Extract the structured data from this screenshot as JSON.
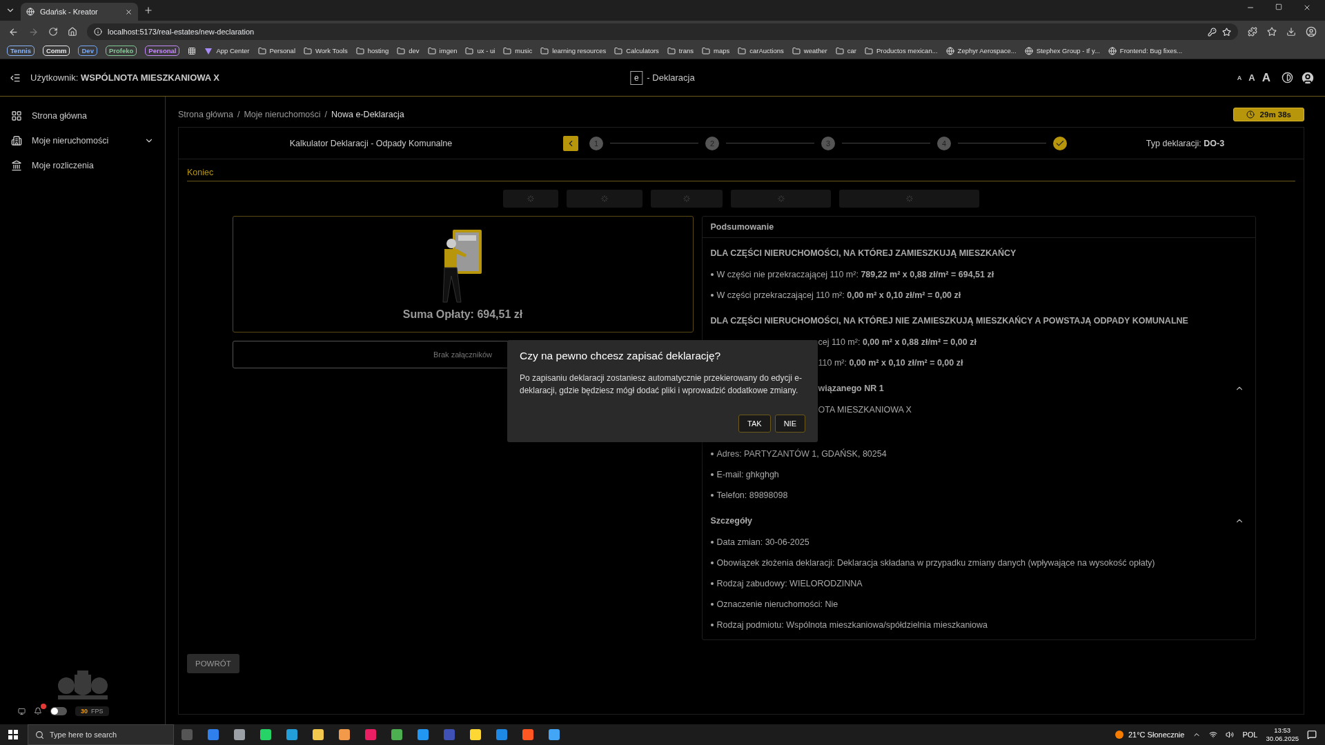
{
  "browser": {
    "tab_title": "Gdańsk - Kreator",
    "url": "localhost:5173/real-estates/new-declaration",
    "tab_groups": [
      {
        "label": "Tennis",
        "color": "#8ab4f8"
      },
      {
        "label": "Comm",
        "color": "#e8eaed"
      },
      {
        "label": "Dev",
        "color": "#78a9f5"
      },
      {
        "label": "Profeko",
        "color": "#81c995"
      },
      {
        "label": "Personal",
        "color": "#c58af9"
      }
    ],
    "bookmarks": [
      {
        "label": "App Center",
        "kind": "app"
      },
      {
        "label": "Personal",
        "kind": "folder"
      },
      {
        "label": "Work Tools",
        "kind": "folder"
      },
      {
        "label": "hosting",
        "kind": "folder"
      },
      {
        "label": "dev",
        "kind": "folder"
      },
      {
        "label": "imgen",
        "kind": "folder"
      },
      {
        "label": "ux - ui",
        "kind": "folder"
      },
      {
        "label": "music",
        "kind": "folder"
      },
      {
        "label": "learning resources",
        "kind": "folder"
      },
      {
        "label": "Calculators",
        "kind": "folder"
      },
      {
        "label": "trans",
        "kind": "folder"
      },
      {
        "label": "maps",
        "kind": "folder"
      },
      {
        "label": "carAuctions",
        "kind": "folder"
      },
      {
        "label": "weather",
        "kind": "folder"
      },
      {
        "label": "car",
        "kind": "folder"
      },
      {
        "label": "Productos mexican...",
        "kind": "folder"
      },
      {
        "label": "Zephyr Aerospace...",
        "kind": "page"
      },
      {
        "label": "Stephex Group - If y...",
        "kind": "page"
      },
      {
        "label": "Frontend: Bug fixes...",
        "kind": "page"
      }
    ]
  },
  "header": {
    "user_label": "Użytkownik:",
    "user_name": "WSPÓLNOTA MIESZKANIOWA X",
    "logo_letter": "e",
    "title": "- Deklaracja",
    "font_sizes": [
      "A",
      "A",
      "A"
    ]
  },
  "sidebar": {
    "items": [
      {
        "label": "Strona główna",
        "expandable": false
      },
      {
        "label": "Moje nieruchomości",
        "expandable": true
      },
      {
        "label": "Moje rozliczenia",
        "expandable": false
      }
    ],
    "toggle_on": false,
    "fps_value": "30",
    "fps_label": "FPS"
  },
  "breadcrumb_separators": [
    "/",
    "/"
  ],
  "breadcrumbs": [
    {
      "label": "Strona główna",
      "current": false
    },
    {
      "label": "Moje nieruchomości",
      "current": false
    },
    {
      "label": "Nowa e-Deklaracja",
      "current": true
    }
  ],
  "timer": "29m 38s",
  "stepper": {
    "title": "Kalkulator Deklaracji - Odpady Komunalne",
    "steps": [
      {
        "label": "1",
        "completed": false
      },
      {
        "label": "2",
        "completed": false
      },
      {
        "label": "3",
        "completed": false
      },
      {
        "label": "4",
        "completed": false
      },
      {
        "completed": true
      }
    ],
    "type_label": "Typ deklaracji:",
    "type_value": "DO-3"
  },
  "section_title": "Koniec",
  "result": {
    "total": "Suma Opłaty: 694,51 zł",
    "attachments": "Brak załączników"
  },
  "summary": {
    "title": "Podsumowanie",
    "sections": [
      {
        "kind": "group",
        "heading": "DLA CZĘŚCI NIERUCHOMOŚCI, NA KTÓREJ ZAMIESZKUJĄ MIESZKAŃCY",
        "items": [
          {
            "text": "W części nie przekraczającej 110 m²: **789,22 m² x 0,88 zł/m² = 694,51 zł**",
            "clipped": false
          },
          {
            "text": "W części przekraczającej 110 m²: **0,00 m² x 0,10 zł/m² = 0,00 zł**",
            "clipped": false
          }
        ]
      },
      {
        "kind": "group",
        "heading": "DLA CZĘŚCI NIERUCHOMOŚCI, NA KTÓREJ NIE ZAMIESZKUJĄ MIESZKAŃCY A POWSTAJĄ ODPADY KOMUNALNE",
        "items": [
          {
            "text": "cej 110 m²: **0,00 m² x 0,88 zł/m² = 0,00 zł**",
            "clipped": true
          },
          {
            "text": "110 m²: **0,00 m² x 0,10 zł/m² = 0,00 zł**",
            "clipped": true
          }
        ]
      },
      {
        "kind": "collapsible",
        "heading": "wiązanego NR 1",
        "heading_clipped": true,
        "expanded": true,
        "items": [
          {
            "text": "OTA MIESZKANIOWA X",
            "clipped": true
          },
          {
            "text": "Adres: PARTYZANTÓW 1, GDAŃSK, 80254",
            "clipped": false
          },
          {
            "text": "E-mail: ghkghgh",
            "clipped": false
          },
          {
            "text": "Telefon: 89898098",
            "clipped": false
          }
        ]
      },
      {
        "kind": "collapsible",
        "heading": "Szczegóły",
        "heading_clipped": false,
        "expanded": true,
        "items": [
          {
            "text": "Data zmian: 30-06-2025",
            "clipped": false
          },
          {
            "text": "Obowiązek złożenia deklaracji: Deklaracja składana w przypadku zmiany danych (wpływające na wysokość opłaty)",
            "clipped": false
          },
          {
            "text": "Rodzaj zabudowy: WIELORODZINNA",
            "clipped": false
          },
          {
            "text": "Oznaczenie nieruchomości: Nie",
            "clipped": false
          },
          {
            "text": "Rodzaj podmiotu: Wspólnota mieszkaniowa/spółdzielnia mieszkaniowa",
            "clipped": false
          }
        ]
      }
    ]
  },
  "back_button": "POWRÓT",
  "dialog": {
    "title": "Czy na pewno chcesz zapisać deklarację?",
    "body": "Po zapisaniu deklaracji zostaniesz automatycznie przekierowany do edycji e-deklaracji, gdzie będziesz mógł dodać pliki i wprowadzić dodatkowe zmiany.",
    "buttons": [
      "TAK",
      "NIE"
    ]
  },
  "taskbar": {
    "search_placeholder": "Type here to search",
    "weather": "21°C Słonecznie",
    "language": "POL",
    "time": "13:53",
    "date": "30.06.2025"
  }
}
